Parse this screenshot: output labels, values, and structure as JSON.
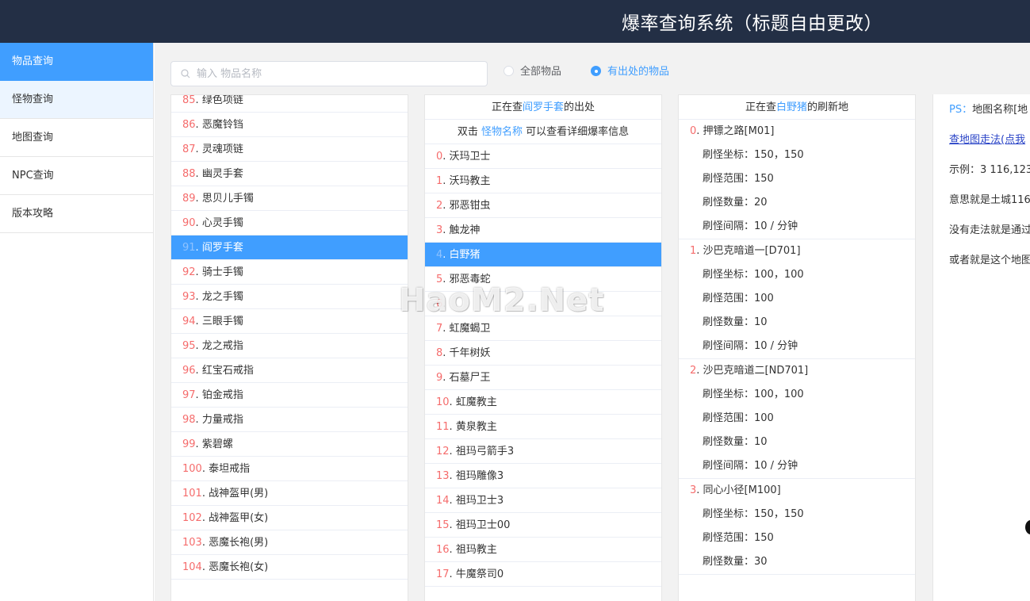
{
  "header": {
    "title": "爆率查询系统（标题自由更改）"
  },
  "sidebar": {
    "items": [
      {
        "label": "物品查询"
      },
      {
        "label": "怪物查询"
      },
      {
        "label": "地图查询"
      },
      {
        "label": "NPC查询"
      },
      {
        "label": "版本攻略"
      }
    ],
    "active_index": 0
  },
  "search": {
    "placeholder": "输入 物品名称",
    "value": ""
  },
  "filter": {
    "options": [
      "全部物品",
      "有出处的物品"
    ],
    "selected": "有出处的物品"
  },
  "items_list": {
    "rows": [
      {
        "num": "85",
        "name": "绿色项链"
      },
      {
        "num": "86",
        "name": "恶魔铃铛"
      },
      {
        "num": "87",
        "name": "灵魂项链"
      },
      {
        "num": "88",
        "name": "幽灵手套"
      },
      {
        "num": "89",
        "name": "思贝儿手镯"
      },
      {
        "num": "90",
        "name": "心灵手镯"
      },
      {
        "num": "91",
        "name": "阎罗手套"
      },
      {
        "num": "92",
        "name": "骑士手镯"
      },
      {
        "num": "93",
        "name": "龙之手镯"
      },
      {
        "num": "94",
        "name": "三眼手镯"
      },
      {
        "num": "95",
        "name": "龙之戒指"
      },
      {
        "num": "96",
        "name": "红宝石戒指"
      },
      {
        "num": "97",
        "name": "铂金戒指"
      },
      {
        "num": "98",
        "name": "力量戒指"
      },
      {
        "num": "99",
        "name": "紫碧螺"
      },
      {
        "num": "100",
        "name": "泰坦戒指"
      },
      {
        "num": "101",
        "name": "战神盔甲(男)"
      },
      {
        "num": "102",
        "name": "战神盔甲(女)"
      },
      {
        "num": "103",
        "name": "恶魔长袍(男)"
      },
      {
        "num": "104",
        "name": "恶魔长袍(女)"
      }
    ],
    "selected_index": 6
  },
  "monsters_panel": {
    "header_prefix": "正在查",
    "header_item": "阎罗手套",
    "header_suffix": "的出处",
    "hint_prefix": "双击",
    "hint_link": "怪物名称",
    "hint_suffix": "可以查看详细爆率信息",
    "rows": [
      {
        "num": "0",
        "name": "沃玛卫士"
      },
      {
        "num": "1",
        "name": "沃玛教主"
      },
      {
        "num": "2",
        "name": "邪恶钳虫"
      },
      {
        "num": "3",
        "name": "触龙神"
      },
      {
        "num": "4",
        "name": "白野猪"
      },
      {
        "num": "5",
        "name": "邪恶毒蛇"
      },
      {
        "num": "6",
        "name": ""
      },
      {
        "num": "7",
        "name": "虹魔蝎卫"
      },
      {
        "num": "8",
        "name": "千年树妖"
      },
      {
        "num": "9",
        "name": "石墓尸王"
      },
      {
        "num": "10",
        "name": "虹魔教主"
      },
      {
        "num": "11",
        "name": "黄泉教主"
      },
      {
        "num": "12",
        "name": "祖玛弓箭手3"
      },
      {
        "num": "13",
        "name": "祖玛雕像3"
      },
      {
        "num": "14",
        "name": "祖玛卫士3"
      },
      {
        "num": "15",
        "name": "祖玛卫士00"
      },
      {
        "num": "16",
        "name": "祖玛教主"
      },
      {
        "num": "17",
        "name": "牛魔祭司0"
      }
    ],
    "selected_index": 4
  },
  "spawn_panel": {
    "header_prefix": "正在查",
    "header_monster": "白野猪",
    "header_suffix": "的刷新地",
    "entries": [
      {
        "num": "0",
        "map": "押镖之路[M01]",
        "coord": "刷怪坐标：150，150",
        "range": "刷怪范围：150",
        "count": "刷怪数量：20",
        "interval": "刷怪间隔：10 / 分钟"
      },
      {
        "num": "1",
        "map": "沙巴克暗道一[D701]",
        "coord": "刷怪坐标：100，100",
        "range": "刷怪范围：100",
        "count": "刷怪数量：10",
        "interval": "刷怪间隔：10 / 分钟"
      },
      {
        "num": "2",
        "map": "沙巴克暗道二[ND701]",
        "coord": "刷怪坐标：100，100",
        "range": "刷怪范围：100",
        "count": "刷怪数量：10",
        "interval": "刷怪间隔：10 / 分钟"
      },
      {
        "num": "3",
        "map": "同心小径[M100]",
        "coord": "刷怪坐标：150，150",
        "range": "刷怪范围：150",
        "count": "刷怪数量：30",
        "interval": ""
      }
    ]
  },
  "ps_panel": {
    "ps_label": "PS：",
    "ps_text": "地图名称[地",
    "link_text": "查地图走法(点我",
    "example": "示例：3 116,123",
    "line1": "意思就是土城116",
    "line2": "没有走法就是通过",
    "line3": "或者就是这个地图"
  },
  "watermark": "HaoM2.Net",
  "colors": {
    "header_bg": "#232f45",
    "accent": "#409eff",
    "number": "#f56c6c",
    "link": "#2a44c7"
  }
}
